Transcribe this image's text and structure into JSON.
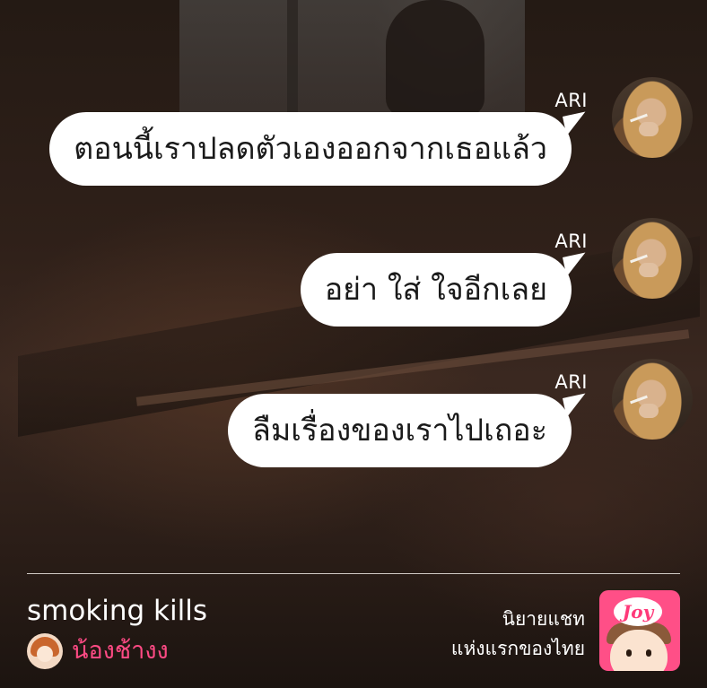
{
  "messages": [
    {
      "sender": "ARI",
      "text": "ตอนนี้เราปลดตัวเองออกจากเธอแล้ว"
    },
    {
      "sender": "ARI",
      "text": "อย่า ใส่ ใจอีกเลย"
    },
    {
      "sender": "ARI",
      "text": "ลืมเรื่องของเราไปเถอะ"
    }
  ],
  "footer": {
    "story_title": "smoking kills",
    "author_name": "น้องช้างง",
    "tagline_line1": "นิยายแชท",
    "tagline_line2": "แห่งแรกของไทย",
    "logo_text": "Joy"
  },
  "colors": {
    "bubble": "#ffffff",
    "author_name": "#ff4a84",
    "brand_pink": "#ff4f87"
  },
  "icons": {
    "sender_avatar": "ari-avatar-photo",
    "author_avatar": "author-avatar-icon",
    "brand_logo": "joy-logo-icon"
  }
}
